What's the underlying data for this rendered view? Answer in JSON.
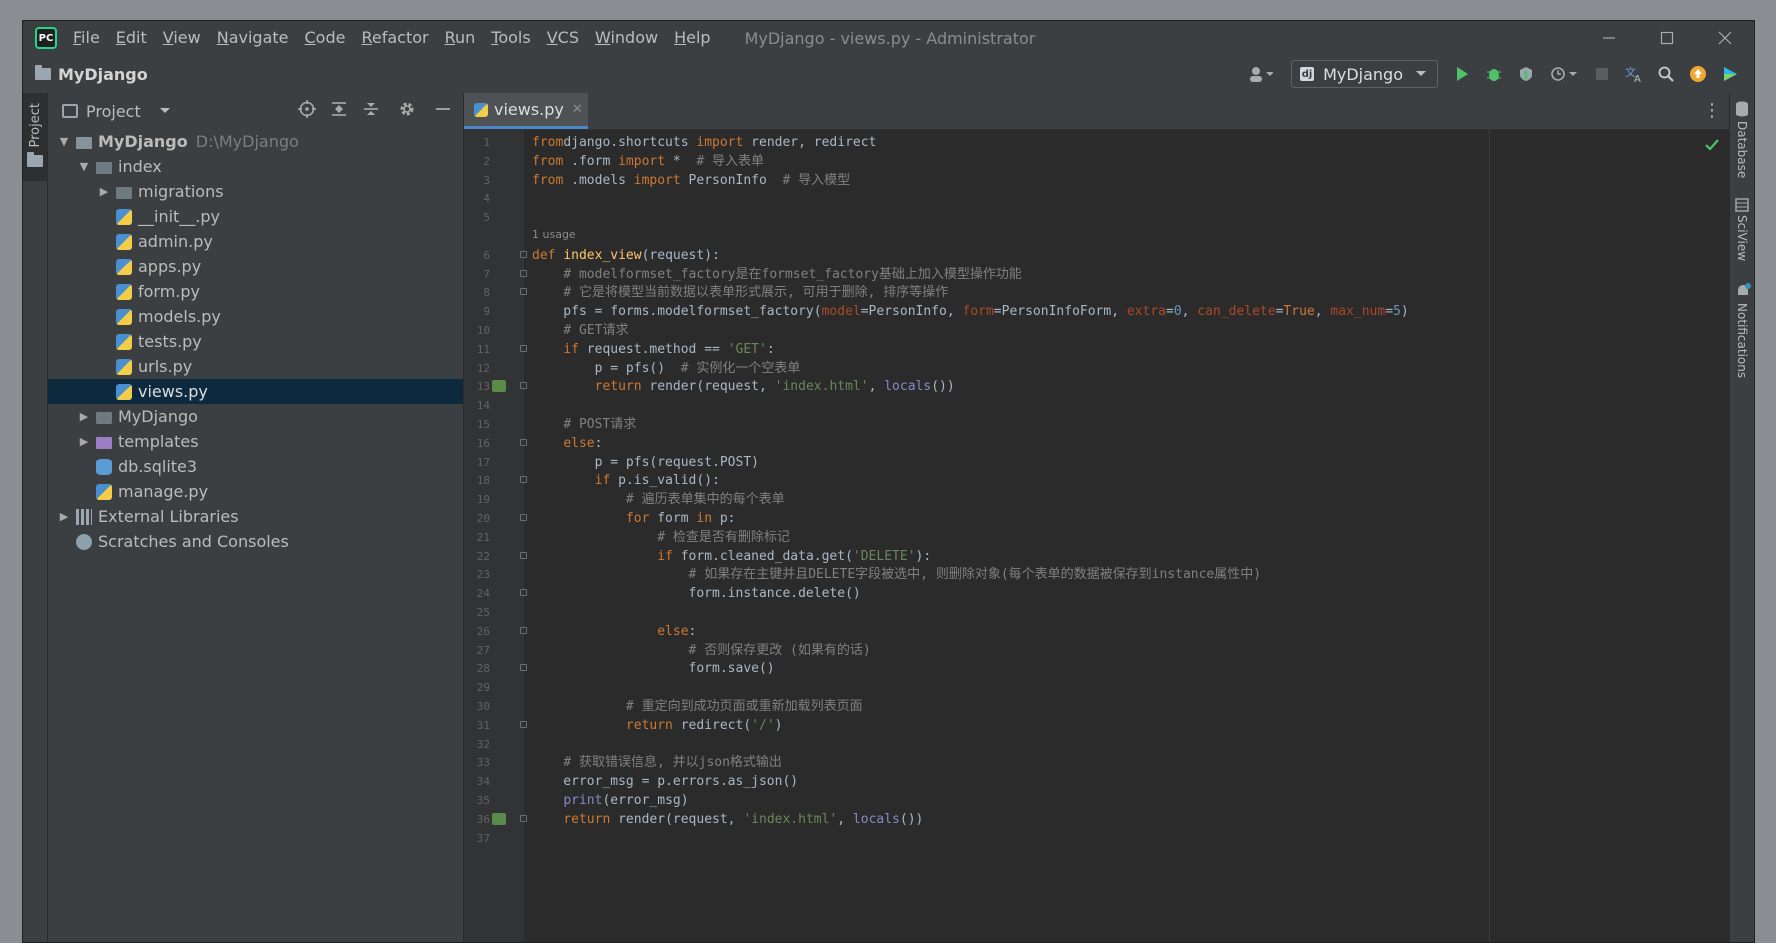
{
  "titlebar": {
    "menu": [
      {
        "first": "F",
        "rest": "ile"
      },
      {
        "first": "E",
        "rest": "dit"
      },
      {
        "first": "V",
        "rest": "iew"
      },
      {
        "first": "N",
        "rest": "avigate"
      },
      {
        "first": "C",
        "rest": "ode"
      },
      {
        "first": "R",
        "rest": "efactor"
      },
      {
        "first": "R",
        "rest": "un"
      },
      {
        "first": "T",
        "rest": "ools"
      },
      {
        "first": "V",
        "rest": "CS"
      },
      {
        "first": "W",
        "rest": "indow"
      },
      {
        "first": "H",
        "rest": "elp"
      }
    ],
    "window_title": "MyDjango - views.py - Administrator",
    "logo_text": "PC"
  },
  "toolbar": {
    "breadcrumb": "MyDjango",
    "run_config": "MyDjango"
  },
  "left_strip": {
    "project_tab": "Project"
  },
  "right_strip": {
    "database": "Database",
    "sciview": "SciView",
    "notifications": "Notifications"
  },
  "project_panel": {
    "title": "Project",
    "tree": [
      {
        "label": "MyDjango",
        "hint": "D:\\MyDjango",
        "depth": 0,
        "arrow": "open",
        "icon": "folder",
        "bold": true
      },
      {
        "label": "index",
        "depth": 1,
        "arrow": "open",
        "icon": "folder-dark"
      },
      {
        "label": "migrations",
        "depth": 2,
        "arrow": "closed",
        "icon": "folder-dark"
      },
      {
        "label": "__init__.py",
        "depth": 2,
        "arrow": "none",
        "icon": "py"
      },
      {
        "label": "admin.py",
        "depth": 2,
        "arrow": "none",
        "icon": "py"
      },
      {
        "label": "apps.py",
        "depth": 2,
        "arrow": "none",
        "icon": "py"
      },
      {
        "label": "form.py",
        "depth": 2,
        "arrow": "none",
        "icon": "py"
      },
      {
        "label": "models.py",
        "depth": 2,
        "arrow": "none",
        "icon": "py"
      },
      {
        "label": "tests.py",
        "depth": 2,
        "arrow": "none",
        "icon": "py"
      },
      {
        "label": "urls.py",
        "depth": 2,
        "arrow": "none",
        "icon": "py"
      },
      {
        "label": "views.py",
        "depth": 2,
        "arrow": "none",
        "icon": "py",
        "selected": true
      },
      {
        "label": "MyDjango",
        "depth": 1,
        "arrow": "closed",
        "icon": "folder-dark"
      },
      {
        "label": "templates",
        "depth": 1,
        "arrow": "closed",
        "icon": "folder-purple"
      },
      {
        "label": "db.sqlite3",
        "depth": 1,
        "arrow": "none",
        "icon": "db"
      },
      {
        "label": "manage.py",
        "depth": 1,
        "arrow": "none",
        "icon": "py"
      },
      {
        "label": "External Libraries",
        "depth": 0,
        "arrow": "closed",
        "icon": "lib"
      },
      {
        "label": "Scratches and Consoles",
        "depth": 0,
        "arrow": "none",
        "icon": "scratch"
      }
    ]
  },
  "editor": {
    "tab_label": "views.py",
    "usage_hint": "1 usage",
    "lines": [
      {
        "n": "1",
        "c": [
          [
            "kw",
            "from"
          ],
          [
            "",
            "django.shortcuts "
          ],
          [
            "kw",
            "import"
          ],
          [
            "",
            " render, redirect"
          ]
        ]
      },
      {
        "n": "2",
        "c": [
          [
            "kw",
            "from"
          ],
          [
            "",
            " .form "
          ],
          [
            "kw",
            "import"
          ],
          [
            "",
            " *  "
          ],
          [
            "cm",
            "# 导入表单"
          ]
        ]
      },
      {
        "n": "3",
        "c": [
          [
            "kw",
            "from"
          ],
          [
            "",
            " .models "
          ],
          [
            "kw",
            "import"
          ],
          [
            "",
            " PersonInfo  "
          ],
          [
            "cm",
            "# 导入模型"
          ]
        ]
      },
      {
        "n": "4",
        "c": []
      },
      {
        "n": "5",
        "c": []
      },
      {
        "n": "6",
        "c": [
          [
            "kw",
            "def "
          ],
          [
            "fn",
            "index_view"
          ],
          [
            "",
            "(request):"
          ]
        ]
      },
      {
        "n": "7",
        "c": [
          [
            "",
            "    "
          ],
          [
            "cm",
            "# modelformset_factory是在formset_factory基础上加入模型操作功能"
          ]
        ]
      },
      {
        "n": "8",
        "c": [
          [
            "",
            "    "
          ],
          [
            "cm",
            "# 它是将模型当前数据以表单形式展示, 可用于删除, 排序等操作"
          ]
        ]
      },
      {
        "n": "9",
        "c": [
          [
            "",
            "    pfs = forms.modelformset_factory("
          ],
          [
            "par",
            "model"
          ],
          [
            "",
            "=PersonInfo, "
          ],
          [
            "par",
            "form"
          ],
          [
            "",
            "=PersonInfoForm, "
          ],
          [
            "par",
            "extra"
          ],
          [
            "",
            "="
          ],
          [
            "num",
            "0"
          ],
          [
            "",
            ", "
          ],
          [
            "par",
            "can_delete"
          ],
          [
            "",
            "="
          ],
          [
            "kw",
            "True"
          ],
          [
            "",
            ", "
          ],
          [
            "par",
            "max_num"
          ],
          [
            "",
            "="
          ],
          [
            "num",
            "5"
          ],
          [
            "",
            ")"
          ]
        ]
      },
      {
        "n": "10",
        "c": [
          [
            "",
            "    "
          ],
          [
            "cm",
            "# GET请求"
          ]
        ]
      },
      {
        "n": "11",
        "c": [
          [
            "",
            "    "
          ],
          [
            "kw",
            "if"
          ],
          [
            "",
            " request.method == "
          ],
          [
            "str",
            "'GET'"
          ],
          [
            "",
            ":"
          ]
        ]
      },
      {
        "n": "12",
        "c": [
          [
            "",
            "        p = pfs()  "
          ],
          [
            "cm",
            "# 实例化一个空表单"
          ]
        ]
      },
      {
        "n": "13",
        "c": [
          [
            "",
            "        "
          ],
          [
            "kw",
            "return"
          ],
          [
            "",
            " render(request, "
          ],
          [
            "str",
            "'index.html'"
          ],
          [
            "",
            ", "
          ],
          [
            "bi",
            "locals"
          ],
          [
            "",
            "())"
          ]
        ]
      },
      {
        "n": "14",
        "c": []
      },
      {
        "n": "15",
        "c": [
          [
            "",
            "    "
          ],
          [
            "cm",
            "# POST请求"
          ]
        ]
      },
      {
        "n": "16",
        "c": [
          [
            "",
            "    "
          ],
          [
            "kw",
            "else"
          ],
          [
            "",
            ":"
          ]
        ]
      },
      {
        "n": "17",
        "c": [
          [
            "",
            "        p = pfs(request.POST)"
          ]
        ]
      },
      {
        "n": "18",
        "c": [
          [
            "",
            "        "
          ],
          [
            "kw",
            "if"
          ],
          [
            "",
            " p.is_valid():"
          ]
        ]
      },
      {
        "n": "19",
        "c": [
          [
            "",
            "            "
          ],
          [
            "cm",
            "# 遍历表单集中的每个表单"
          ]
        ]
      },
      {
        "n": "20",
        "c": [
          [
            "",
            "            "
          ],
          [
            "kw",
            "for"
          ],
          [
            "",
            " form "
          ],
          [
            "kw",
            "in"
          ],
          [
            "",
            " p:"
          ]
        ]
      },
      {
        "n": "21",
        "c": [
          [
            "",
            "                "
          ],
          [
            "cm",
            "# 检查是否有删除标记"
          ]
        ]
      },
      {
        "n": "22",
        "c": [
          [
            "",
            "                "
          ],
          [
            "kw",
            "if"
          ],
          [
            "",
            " form.cleaned_data.get("
          ],
          [
            "str",
            "'DELETE'"
          ],
          [
            "",
            "):"
          ]
        ]
      },
      {
        "n": "23",
        "c": [
          [
            "",
            "                    "
          ],
          [
            "cm",
            "# 如果存在主键并且DELETE字段被选中, 则删除对象(每个表单的数据被保存到instance属性中)"
          ]
        ]
      },
      {
        "n": "24",
        "c": [
          [
            "",
            "                    form.instance.delete()"
          ]
        ]
      },
      {
        "n": "25",
        "c": []
      },
      {
        "n": "26",
        "c": [
          [
            "",
            "                "
          ],
          [
            "kw",
            "else"
          ],
          [
            "",
            ":"
          ]
        ]
      },
      {
        "n": "27",
        "c": [
          [
            "",
            "                    "
          ],
          [
            "cm",
            "# 否则保存更改 (如果有的话)"
          ]
        ]
      },
      {
        "n": "28",
        "c": [
          [
            "",
            "                    form.save()"
          ]
        ]
      },
      {
        "n": "29",
        "c": []
      },
      {
        "n": "30",
        "c": [
          [
            "",
            "            "
          ],
          [
            "cm",
            "# 重定向到成功页面或重新加载列表页面"
          ]
        ]
      },
      {
        "n": "31",
        "c": [
          [
            "",
            "            "
          ],
          [
            "kw",
            "return"
          ],
          [
            "",
            " redirect("
          ],
          [
            "str",
            "'/'"
          ],
          [
            "",
            ")"
          ]
        ]
      },
      {
        "n": "32",
        "c": []
      },
      {
        "n": "33",
        "c": [
          [
            "",
            "    "
          ],
          [
            "cm",
            "# 获取错误信息, 并以json格式输出"
          ]
        ]
      },
      {
        "n": "34",
        "c": [
          [
            "",
            "    error_msg = p.errors.as_json()"
          ]
        ]
      },
      {
        "n": "35",
        "c": [
          [
            "",
            "    "
          ],
          [
            "bi",
            "print"
          ],
          [
            "",
            "(error_msg)"
          ]
        ]
      },
      {
        "n": "36",
        "c": [
          [
            "",
            "    "
          ],
          [
            "kw",
            "return"
          ],
          [
            "",
            " render(request, "
          ],
          [
            "str",
            "'index.html'"
          ],
          [
            "",
            ", "
          ],
          [
            "bi",
            "locals"
          ],
          [
            "",
            "())"
          ]
        ]
      },
      {
        "n": "37",
        "c": []
      }
    ]
  },
  "colors": {
    "keyword": "#cc7832",
    "function": "#ffc66d",
    "string": "#6a8759",
    "comment": "#808080",
    "number": "#6897bb",
    "param": "#aa4926",
    "selection": "#0d293e",
    "accent": "#4a88c7"
  }
}
